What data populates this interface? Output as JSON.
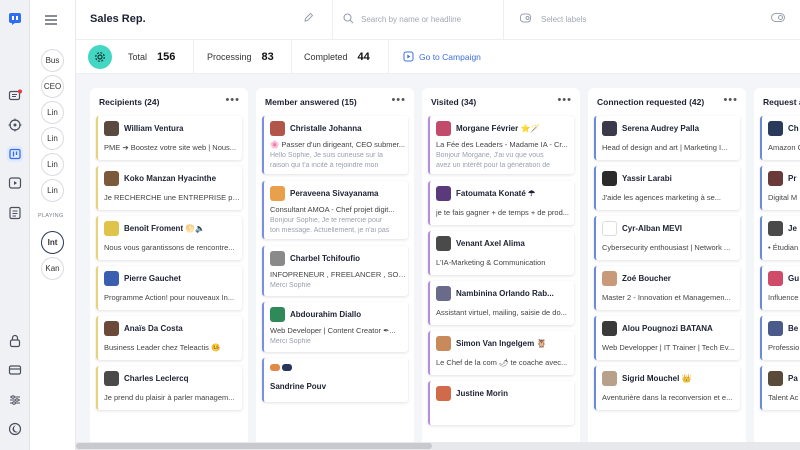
{
  "rail": {
    "icons": [
      "logo-icon",
      "chat-icon",
      "target-icon",
      "board-icon",
      "video-icon",
      "list-icon",
      "lock-icon",
      "card-icon",
      "sliders-icon",
      "moon-icon"
    ]
  },
  "personas": [
    "Bus",
    "CEO",
    "Lin",
    "Lin",
    "Lin",
    "Lin"
  ],
  "playing_label": "PLAYING",
  "playing": [
    "Int",
    "Kan"
  ],
  "header": {
    "title": "Sales Rep.",
    "search_placeholder": "Search by name or headline",
    "labels_placeholder": "Select labels"
  },
  "stats": {
    "total_label": "Total",
    "total": "156",
    "processing_label": "Processing",
    "processing": "83",
    "completed_label": "Completed",
    "completed": "44",
    "campaign_link": "Go to Campaign"
  },
  "columns": [
    {
      "title": "Recipients (24)",
      "cards": [
        {
          "name": "William Ventura",
          "line": "PME ➔ Boostez votre site web | Nous...",
          "accent": "#e9d37a",
          "avatar": "#5a4a3f"
        },
        {
          "name": "Koko Manzan Hyacinthe",
          "line": "Je RECHERCHE une ENTREPRISE pour...",
          "accent": "#e9d37a",
          "avatar": "#7a5a3a"
        },
        {
          "name": "Benoît Froment 🌕🔈",
          "line": "Nous vous garantissons de rencontre...",
          "accent": "#e9d37a",
          "avatar": "#e0c34a"
        },
        {
          "name": "Pierre Gauchet",
          "line": "Programme Action! pour nouveaux In...",
          "accent": "#e9d37a",
          "avatar": "#3b5fb0"
        },
        {
          "name": "Anaïs Da Costa",
          "line": "Business Leader chez Teleactis 🤒",
          "accent": "#e9d37a",
          "avatar": "#6b4a3a"
        },
        {
          "name": "Charles Leclercq",
          "line": "Je prend du plaisir à parler managem...",
          "accent": "#e9d37a",
          "avatar": "#4a4a4a"
        }
      ]
    },
    {
      "title": "Member answered (15)",
      "cards": [
        {
          "name": "Christalle Johanna",
          "line": "🌸 Passer d'un dirigeant, CEO submer...",
          "line2": "Hello Sophie, Je suis curieuse sur la",
          "line3": "raison qui t'a incité à rejoindre mon",
          "accent": "#7b8fe0",
          "avatar": "#b2564a",
          "tall": true
        },
        {
          "name": "Peraveena Sivayanama",
          "line": "Consultant AMOA - Chef projet digit...",
          "line2": "Bonjour Sophie, Je te remercie pour",
          "line3": "ton message. Actuellement, je n'ai pas",
          "accent": "#7b8fe0",
          "avatar": "#e8a04a",
          "tall": true
        },
        {
          "name": "Charbel Tchifoufio",
          "line": "INFOPRENEUR , FREELANCER , SOCI...",
          "line2": "Merci Sophie",
          "accent": "#7b8fe0",
          "avatar": "#8a8a8a",
          "tall": true
        },
        {
          "name": "Abdourahim Diallo",
          "line": "Web Developer | Content Creator ✒...",
          "line2": "Merci Sophie",
          "accent": "#7b8fe0",
          "avatar": "#2f8a5a",
          "tall": true
        },
        {
          "name": "Sandrine Pouv",
          "line": "",
          "accent": "#7b8fe0",
          "avatar": "#e08a4a"
        }
      ]
    },
    {
      "title": "Visited (34)",
      "cards": [
        {
          "name": "Morgane Février ⭐🪄",
          "line": "La Fée des Leaders - Madame IA - Cr...",
          "line2": "Bonjour Morgane, J'ai vu que vous",
          "line3": "avez un intérêt pour la génération de",
          "accent": "#b58ee0",
          "avatar": "#c24a6a",
          "tall": true
        },
        {
          "name": "Fatoumata Konaté ☂",
          "line": "je te fais gagner + de temps + de prod...",
          "accent": "#b58ee0",
          "avatar": "#5a3a7a"
        },
        {
          "name": "Venant Axel Alima",
          "line": "L'IA-Marketing & Communication",
          "accent": "#b58ee0",
          "avatar": "#4a4a4a"
        },
        {
          "name": "Nambinina Orlando Rab...",
          "line": "Assistant virtuel, mailing, saisie de do...",
          "accent": "#b58ee0",
          "avatar": "#6a6a8a"
        },
        {
          "name": "Simon Van Ingelgem 🦉",
          "line": "Le Chef de la com 🌶 te coache avec...",
          "accent": "#b58ee0",
          "avatar": "#c88a5a"
        },
        {
          "name": "Justine Morin",
          "line": "",
          "accent": "#b58ee0",
          "avatar": "#d06a4a"
        }
      ]
    },
    {
      "title": "Connection requested (42)",
      "cards": [
        {
          "name": "Serena Audrey Palla",
          "line": "Head of design and art | Marketing I...",
          "accent": "#6a8ad8",
          "avatar": "#3a3a4a"
        },
        {
          "name": "Yassir Larabi",
          "line": "J'aide les agences marketing à se...",
          "accent": "#6a8ad8",
          "avatar": "#2a2a2a"
        },
        {
          "name": "Cyr-Alban MEVI",
          "line": "Cybersecurity enthousiast | Network ...",
          "accent": "#6a8ad8",
          "avatar": "#ffffff"
        },
        {
          "name": "Zoé Boucher",
          "line": "Master 2 - Innovation et Managemen...",
          "accent": "#6a8ad8",
          "avatar": "#c89a7a"
        },
        {
          "name": "Alou Pougnozi BATANA",
          "line": "Web Developper | IT Trainer | Tech Ev...",
          "accent": "#6a8ad8",
          "avatar": "#3a3a3a"
        },
        {
          "name": "Sigrid Mouchel 👑",
          "line": "Aventurière dans la reconversion et e...",
          "accent": "#6a8ad8",
          "avatar": "#b8a08a"
        }
      ]
    },
    {
      "title": "Request a",
      "cards": [
        {
          "name": "Ch",
          "line": "Amazon C",
          "accent": "#6a8ad8",
          "avatar": "#2a3a5a"
        },
        {
          "name": "Pr",
          "line": "Digital M",
          "accent": "#6a8ad8",
          "avatar": "#6a3a3a"
        },
        {
          "name": "Je",
          "line": "• Étudian",
          "accent": "#6a8ad8",
          "avatar": "#4a4a4a"
        },
        {
          "name": "Gu",
          "line": "Influence",
          "accent": "#6a8ad8",
          "avatar": "#d04a6a"
        },
        {
          "name": "Be",
          "line": "Professio",
          "accent": "#6a8ad8",
          "avatar": "#4a5a8a"
        },
        {
          "name": "Pa",
          "line": "Talent Ac",
          "accent": "#6a8ad8",
          "avatar": "#5a4a3a"
        }
      ]
    }
  ]
}
